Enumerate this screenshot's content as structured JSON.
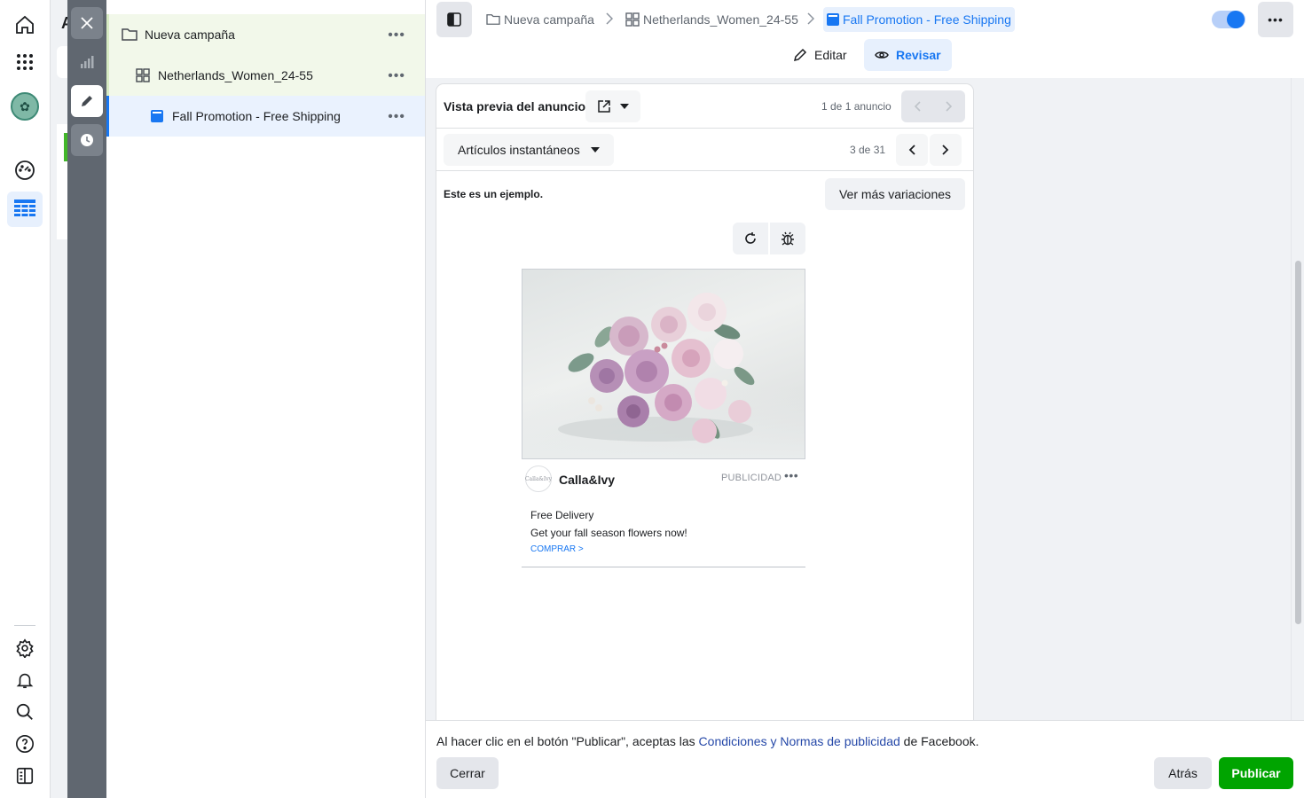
{
  "rail": {
    "icons": [
      "home-icon",
      "apps-grid-icon",
      "account-avatar",
      "dashboard-gauge-icon",
      "ads-manager-table-icon",
      "settings-icon",
      "notifications-icon",
      "search-icon",
      "help-icon",
      "panel-toggle-icon"
    ],
    "active": "ads-manager-table-icon"
  },
  "background_letter": "A",
  "tools": [
    "close-icon",
    "chart-icon",
    "edit-pencil-icon",
    "history-clock-icon"
  ],
  "tree": {
    "campaign": "Nueva campaña",
    "adset": "Netherlands_Women_24-55",
    "ad": "Fall Promotion - Free Shipping",
    "more": "•••"
  },
  "breadcrumb": {
    "campaign": "Nueva campaña",
    "adset": "Netherlands_Women_24-55",
    "ad": "Fall Promotion - Free Shipping"
  },
  "toggle_on": true,
  "more_label": "•••",
  "modes": {
    "edit": "Editar",
    "review": "Revisar",
    "active": "review"
  },
  "preview": {
    "title": "Vista previa del anuncio",
    "ad_count": "1 de 1 anuncio",
    "placement": "Artículos instantáneos",
    "placement_count": "3 de 31",
    "example_note": "Este es un ejemplo.",
    "more_variations": "Ver más variaciones"
  },
  "ad": {
    "brand": "Calla&Ivy",
    "logo_text": "Calla&Ivy",
    "sponsored": "PUBLICIDAD",
    "more": "•••",
    "headline": "Free Delivery",
    "body": "Get your fall season flowers now!",
    "cta": "COMPRAR >",
    "image": "bouquet of pink and purple roses"
  },
  "footer": {
    "legal_prefix": "Al hacer clic en el botón \"Publicar\", aceptas las ",
    "legal_link": "Condiciones y Normas de publicidad",
    "legal_suffix": " de Facebook.",
    "close": "Cerrar",
    "back": "Atrás",
    "publish": "Publicar"
  },
  "colors": {
    "accent": "#1877f2",
    "publish_green": "#00a400",
    "campaign_row_bg": "#f2f8ea",
    "ad_row_bg": "#eaf2fe",
    "tool_strip": "#606770"
  }
}
